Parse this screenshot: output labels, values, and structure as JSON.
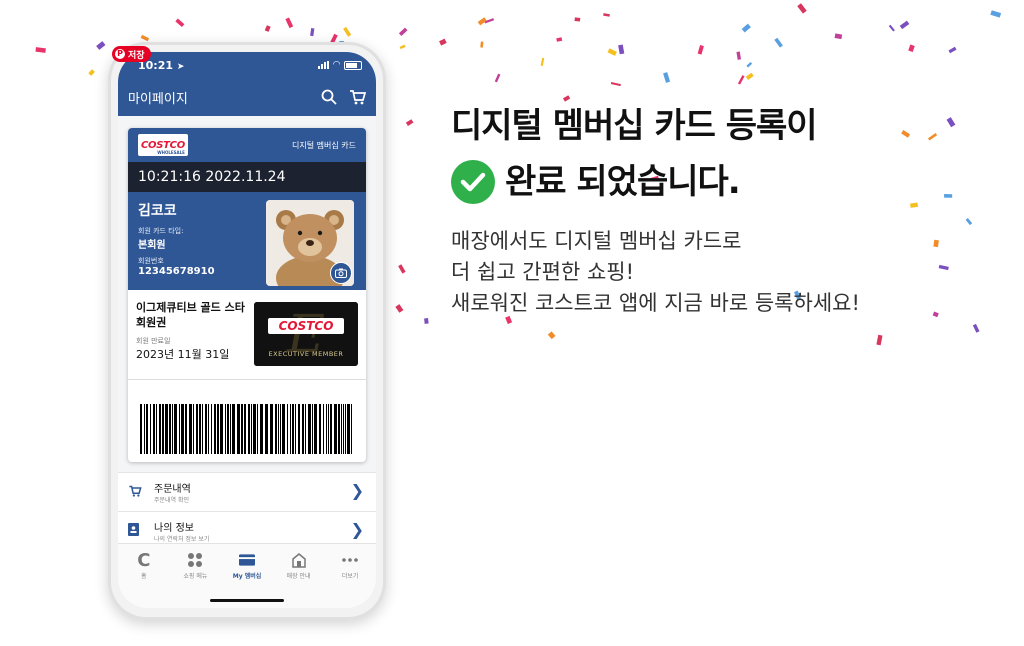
{
  "badge": {
    "label": "저장"
  },
  "status_bar": {
    "time": "10:21"
  },
  "header": {
    "title": "마이페이지"
  },
  "card": {
    "brand": "COSTCO",
    "brand_sub": "WHOLESALE",
    "type_label": "디지털 멤버십 카드",
    "timestamp": "10:21:16 2022.11.24",
    "member_name": "김코코",
    "card_type_label": "회원 카드 타입:",
    "card_type_value": "본회원",
    "member_no_label": "회원번호",
    "member_no_value": "12345678910",
    "exec_title": "이그제큐티브 골드 스타 회원권",
    "expiry_label": "회원 만료일",
    "expiry_value": "2023년 11월 31일",
    "exec_card_text": "EXECUTIVE MEMBER"
  },
  "menu": [
    {
      "title": "주문내역",
      "subtitle": "주문내역 확인"
    },
    {
      "title": "나의 정보",
      "subtitle": "나의 연락처 정보 보기"
    }
  ],
  "tabs": [
    {
      "label": "홈",
      "icon": "home-c-icon"
    },
    {
      "label": "쇼핑 메뉴",
      "icon": "grid-icon"
    },
    {
      "label": "My 멤버십",
      "icon": "card-icon"
    },
    {
      "label": "매장 안내",
      "icon": "store-icon"
    },
    {
      "label": "더보기",
      "icon": "more-icon"
    }
  ],
  "headline": {
    "line1": "디지털 멤버십 카드 등록이",
    "line2": "완료 되었습니다."
  },
  "body": {
    "line1": "매장에서도 디지털 멤버십 카드로",
    "line2": "더 쉽고 간편한 쇼핑!",
    "line3": "새로워진 코스트코 앱에 지금 바로 등록하세요!"
  },
  "colors": {
    "primary": "#2f5796",
    "check": "#2fb04a",
    "costco_red": "#e31837"
  }
}
